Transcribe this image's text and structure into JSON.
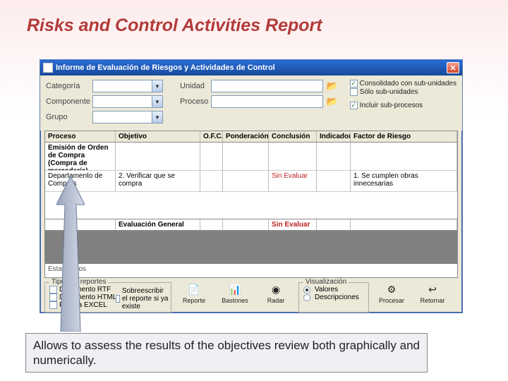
{
  "slide": {
    "title": "Risks and Control Activities Report",
    "callout": "Allows to assess the results of the objectives review both graphically and numerically."
  },
  "window": {
    "title": "Informe de Evaluación de Riesgos y Actividades de Control"
  },
  "filters": {
    "categoria_label": "Categoría",
    "componente_label": "Componente",
    "grupo_label": "Grupo",
    "unidad_label": "Unidad",
    "proceso_label": "Proceso",
    "check1": "Consolidado con sub-unidades",
    "check2": "Sólo sub-unidades",
    "check3": "Incluir sub-procesos"
  },
  "grid": {
    "headers": {
      "proceso": "Proceso",
      "objetivo": "Objetivo",
      "ofc": "O.F.C.",
      "ponderacion": "Ponderación",
      "conclusion": "Conclusión",
      "indicador": "Indicador",
      "factor": "Factor de Riesgo"
    },
    "rows": [
      {
        "proceso": "Emisión de Orden de Compra (Compra de mercadería)",
        "objetivo": "",
        "ofc": "",
        "ponderacion": "",
        "conclusion": "",
        "indicador": "",
        "factor": ""
      },
      {
        "proceso": "Departamento de Compras",
        "objetivo": "2. Verificar que se compra",
        "ofc": "",
        "ponderacion": "",
        "conclusion": "Sin Evaluar",
        "indicador": "",
        "factor": "1. Se cumplen obras innecesarias"
      }
    ],
    "eval_general_label": "Evaluación General",
    "eval_general_value": "Sin Evaluar",
    "stats_label": "Estadísticos"
  },
  "bottom": {
    "group_reportes": "Tipos de reportes",
    "rtf": "Documento RTF",
    "html": "Documento HTML",
    "excel": "Planilla EXCEL",
    "sobre": "Sobreescribir el reporte si ya existe",
    "group_vis": "Visualización",
    "vis_valores": "Valores",
    "vis_desc": "Descripciones",
    "btn_reporte": "Reporte",
    "btn_bastones": "Bastones",
    "btn_radar": "Radar",
    "btn_procesar": "Procesar",
    "btn_retornar": "Retornar"
  }
}
